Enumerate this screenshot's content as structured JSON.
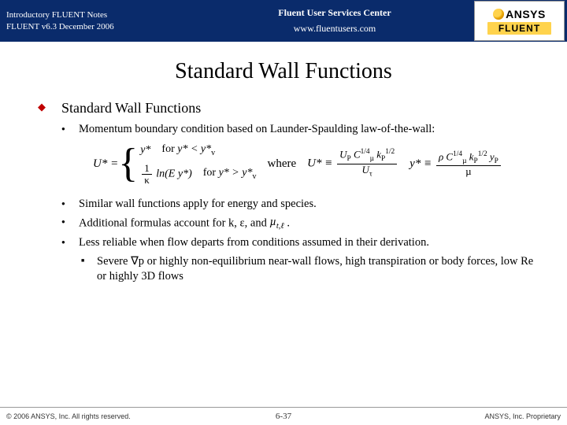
{
  "header": {
    "left_line1": "Introductory FLUENT Notes",
    "left_line2": "FLUENT v6.3 December 2006",
    "center_line1": "Fluent User Services Center",
    "center_line2": "www.fluentusers.com",
    "logo_top": "ANSYS",
    "logo_bottom": "FLUENT"
  },
  "title": "Standard Wall Functions",
  "body": {
    "h1": "Standard Wall Functions",
    "b1": "Momentum boundary condition based on Launder-Spaulding law-of-the-wall:",
    "where": "where",
    "b2": "Similar wall functions apply for energy and species.",
    "b3_pre": "Additional formulas account for k, ε, and ",
    "b3_sym": "µ",
    "b3_sub": "t,ℓ",
    "b3_post": " .",
    "b4": "Less reliable when flow departs from conditions assumed in their derivation.",
    "sub1": "Severe ∇p or highly non-equilibrium near-wall flows, high transpiration or body forces, low Re or highly 3D flows"
  },
  "eq": {
    "lhs": "U* =",
    "case1_expr": "y*",
    "case1_cond_pre": "for ",
    "case1_cond": "y* < y*",
    "case1_cond_sub": "v",
    "case2_num": "1",
    "case2_den": "κ",
    "case2_rest": " ln(E y*)",
    "case2_cond_pre": "for ",
    "case2_cond": "y* > y*",
    "case2_cond_sub": "v",
    "u_lhs": "U* ≡ ",
    "u_num": "U",
    "u_num_sub": "P",
    "u_num_rest": " C",
    "u_num_sup": "1/4",
    "u_num_mu": "µ",
    "u_num_k": " k",
    "u_num_ksub": "P",
    "u_num_ksup": "1/2",
    "u_den": "U",
    "u_den_sub": "τ",
    "y_lhs": "y* ≡ ",
    "y_num_rho": "ρ C",
    "y_num_sup": "1/4",
    "y_num_mu": "µ",
    "y_num_k": " k",
    "y_num_ksub": "P",
    "y_num_ksup": "1/2",
    "y_num_y": " y",
    "y_num_ysub": "P",
    "y_den": "µ"
  },
  "footer": {
    "left": "© 2006 ANSYS, Inc. All rights reserved.",
    "center": "6-37",
    "right": "ANSYS, Inc. Proprietary"
  }
}
